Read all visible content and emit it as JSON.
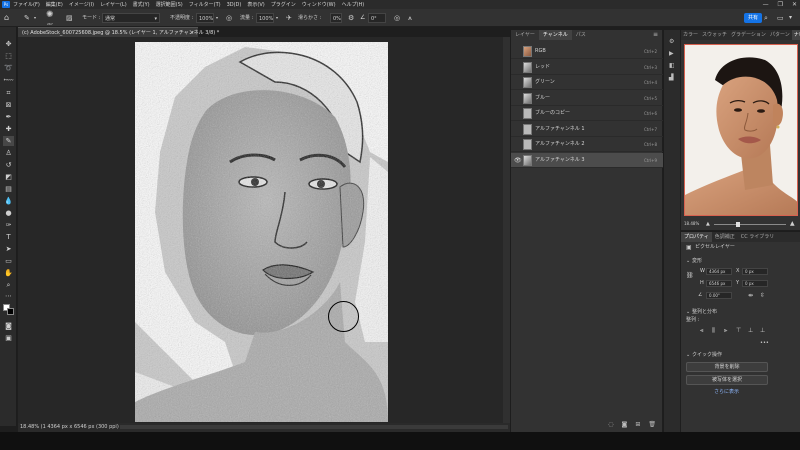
{
  "menubar": {
    "logo": "Ps",
    "items": [
      "ファイル(F)",
      "編集(E)",
      "イメージ(I)",
      "レイヤー(L)",
      "書式(Y)",
      "選択範囲(S)",
      "フィルター(T)",
      "3D(D)",
      "表示(V)",
      "プラグイン",
      "ウィンドウ(W)",
      "ヘルプ(H)"
    ],
    "window_controls": [
      "—",
      "❐",
      "✕"
    ]
  },
  "options": {
    "brush_size": "267",
    "mode_label": "モード :",
    "mode_value": "通常",
    "opacity_label": "不透明度 :",
    "opacity_value": "100%",
    "flow_label": "流量 :",
    "flow_value": "100%",
    "smoothing_label": "滑らかさ :",
    "smoothing_value": "0%",
    "angle_value": "0°",
    "share_label": "共有"
  },
  "document": {
    "tab_title": "(c) AdobeStock_600725608.jpeg @ 18.5% (レイヤー 1, アルファチャンネル 3/8) *",
    "tab_close": "×",
    "status": "18.48%  (1 4364 px x 6546 px (300 ppi)  ›"
  },
  "channels_panel": {
    "tabs": [
      "レイヤー",
      "チャンネル",
      "パス"
    ],
    "active_tab": "チャンネル",
    "rows": [
      {
        "name": "RGB",
        "key": "Ctrl+2",
        "visible": false,
        "selected": false,
        "thumb": "color"
      },
      {
        "name": "レッド",
        "key": "Ctrl+3",
        "visible": false,
        "selected": false,
        "thumb": "gray"
      },
      {
        "name": "グリーン",
        "key": "Ctrl+4",
        "visible": false,
        "selected": false,
        "thumb": "gray"
      },
      {
        "name": "ブルー",
        "key": "Ctrl+5",
        "visible": false,
        "selected": false,
        "thumb": "gray"
      },
      {
        "name": "ブルーのコピー",
        "key": "Ctrl+6",
        "visible": false,
        "selected": false,
        "thumb": "plain"
      },
      {
        "name": "アルファチャンネル 1",
        "key": "Ctrl+7",
        "visible": false,
        "selected": false,
        "thumb": "plain"
      },
      {
        "name": "アルファチャンネル 2",
        "key": "Ctrl+8",
        "visible": false,
        "selected": false,
        "thumb": "plain"
      },
      {
        "name": "アルファチャンネル 3",
        "key": "Ctrl+9",
        "visible": true,
        "selected": true,
        "thumb": "gray"
      }
    ]
  },
  "navigator_panel": {
    "tabs": [
      "カラー",
      "スウォッチ",
      "グラデーション",
      "パターン",
      "ナビゲーター"
    ],
    "zoom": "18.48%"
  },
  "properties_panel": {
    "tabs": [
      "プロパティ",
      "色調補正",
      "CC ライブラリ"
    ],
    "layer_type": "ピクセルレイヤー",
    "transform_label": "変形",
    "w_label": "W",
    "w_value": "4364 px",
    "h_label": "H",
    "h_value": "6546 px",
    "x_label": "X",
    "x_value": "0 px",
    "y_label": "Y",
    "y_value": "0 px",
    "angle_value": "0.00°",
    "align_label": "整列と分布",
    "align_sub": "整列 :",
    "quick_label": "クイック操作",
    "btn_remove_bg": "背景を削除",
    "btn_select_subject": "被写体を選択",
    "more_link": "さらに表示",
    "more_dots": "•••"
  },
  "colors": {
    "accent": "#1473e6",
    "nav_frame": "#d8614f",
    "selected_row": "#4c4c4c"
  }
}
